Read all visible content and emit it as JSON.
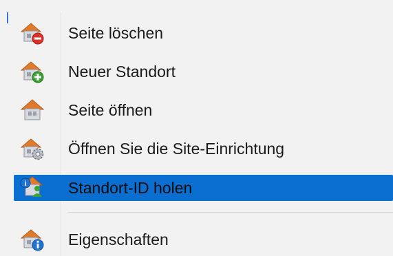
{
  "menu": {
    "items": [
      {
        "label": "Seite löschen",
        "icon": "house-delete-icon"
      },
      {
        "label": "Neuer Standort",
        "icon": "house-add-icon"
      },
      {
        "label": "Seite öffnen",
        "icon": "house-icon"
      },
      {
        "label": "Öffnen Sie die Site-Einrichtung",
        "icon": "house-settings-icon"
      },
      {
        "label": "Standort-ID holen",
        "icon": "house-user-id-icon",
        "selected": true
      },
      {
        "label": "Eigenschaften",
        "icon": "house-info-icon"
      }
    ],
    "colors": {
      "background": "#f2f2f2",
      "highlight": "#0a6fd0",
      "roof": "#e07a2c",
      "house_body": "#c9ccd4",
      "delete_badge": "#d9342b",
      "add_badge": "#3aa335",
      "info_badge": "#1f73d1"
    }
  }
}
